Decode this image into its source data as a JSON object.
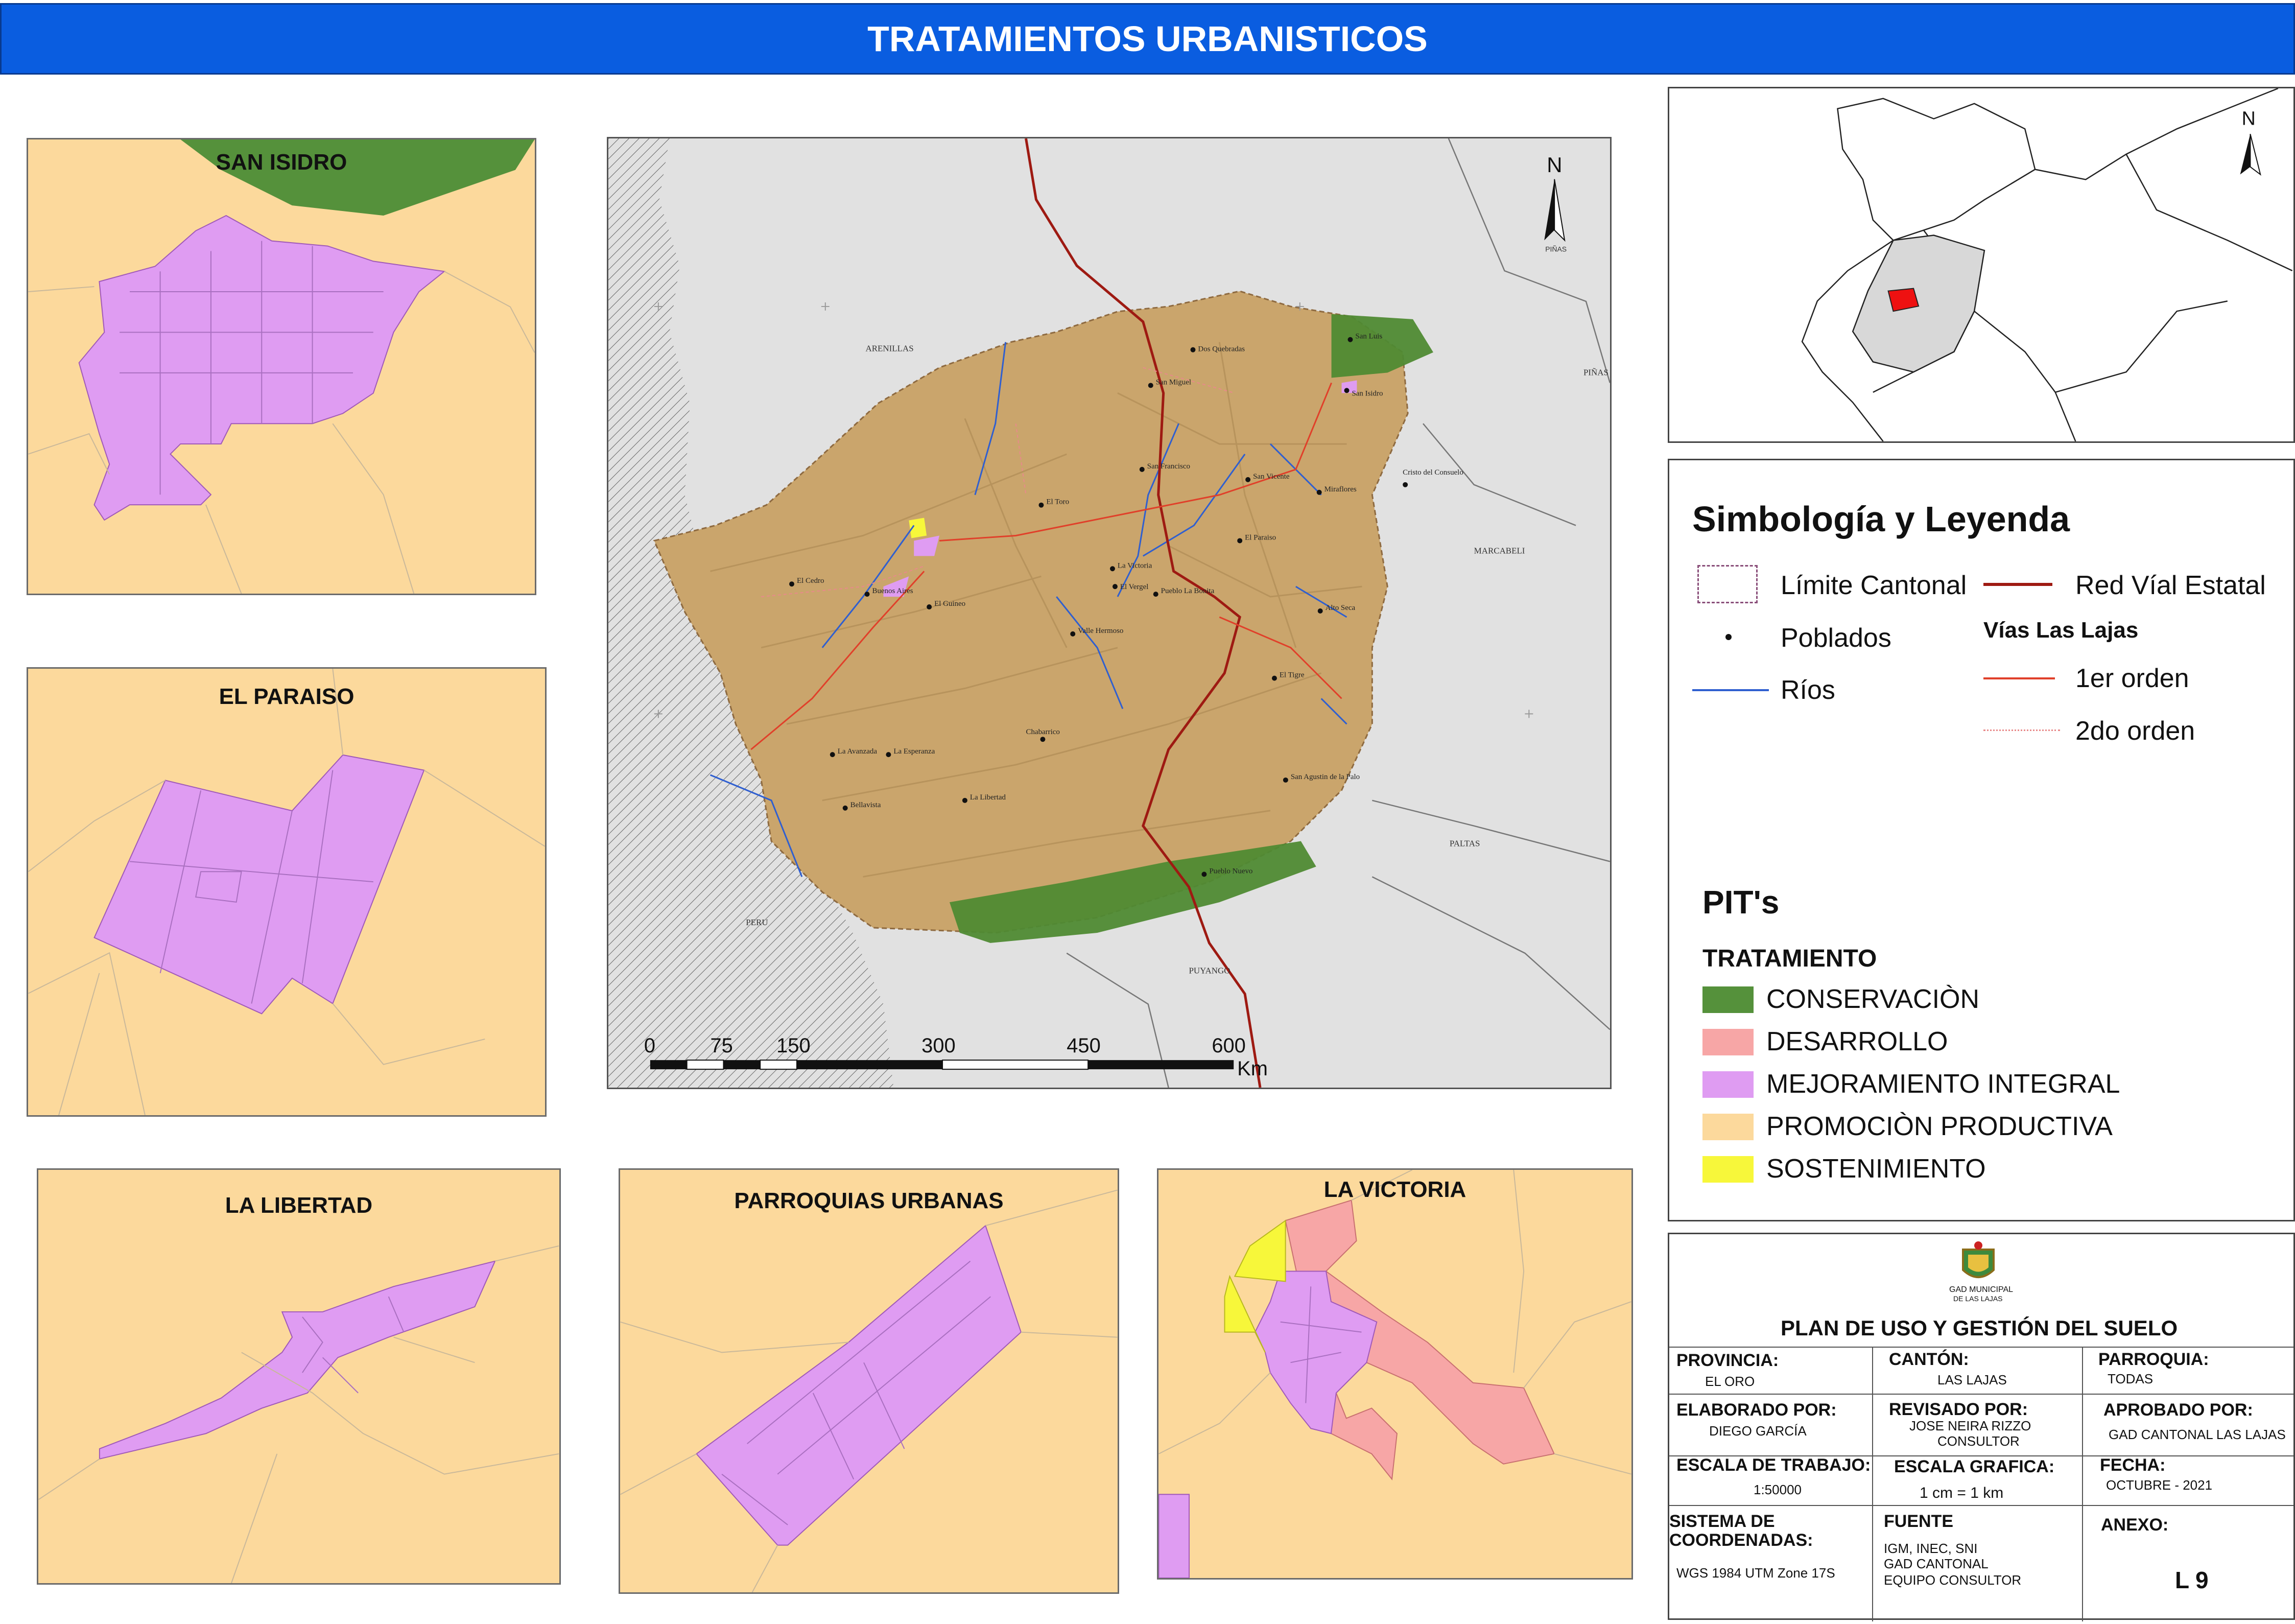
{
  "header": {
    "title": "TRATAMIENTOS URBANISTICOS"
  },
  "insets": {
    "san_isidro": "SAN ISIDRO",
    "el_paraiso": "EL PARAISO",
    "la_libertad": "LA LIBERTAD",
    "parroquias_urbanas": "PARROQUIAS URBANAS",
    "la_victoria": "LA VICTORIA"
  },
  "main_map": {
    "north": "N",
    "north_sub": "PIÑAS",
    "neighbors": [
      "ARENILLAS",
      "PIÑAS",
      "MARCABELI",
      "PALTAS",
      "PERU",
      "PUYANGO"
    ],
    "towns": [
      "Dos Quebradas",
      "San Luis",
      "San Miguel",
      "San Isidro",
      "San Francisco",
      "San Vicente",
      "Miraflores",
      "Cristo del Consuelo",
      "El Toro",
      "El Paraiso",
      "La Victoria",
      "El Vergel",
      "Pueblo La Bonita",
      "El Cedro",
      "Buenos Aires",
      "El Guineo",
      "Valle Hermoso",
      "Alto Seca",
      "El Tigre",
      "Chabarrico",
      "La Avanzada",
      "La Esperanza",
      "Bellavista",
      "La Libertad",
      "San Agustin de la Palo",
      "Pueblo Nuevo"
    ],
    "scale_labels": [
      "0",
      "75",
      "150",
      "300",
      "450",
      "600"
    ],
    "scale_unit": "Km"
  },
  "locator": {
    "north": "N"
  },
  "legend": {
    "title": "Simbología y Leyenda",
    "limite": "Límite Cantonal",
    "red_vial": "Red Víal Estatal",
    "poblados": "Poblados",
    "vias_title": "Vías Las Lajas",
    "rios": "Ríos",
    "primer_orden": "1er orden",
    "segundo_orden": "2do orden",
    "pits_title": "PIT's",
    "tratamiento_title": "TRATAMIENTO",
    "items": [
      {
        "label": "CONSERVACIÒN",
        "color": "#55913b"
      },
      {
        "label": "DESARROLLO",
        "color": "#f7a6a6"
      },
      {
        "label": "MEJORAMIENTO INTEGRAL",
        "color": "#df9cf2"
      },
      {
        "label": "PROMOCIÒN PRODUCTIVA",
        "color": "#fcd99c"
      },
      {
        "label": "SOSTENIMIENTO",
        "color": "#f7f73a"
      }
    ]
  },
  "titleblock": {
    "org_name": "GAD MUNICIPAL",
    "org_sub": "DE LAS LAJAS",
    "plan_title": "PLAN DE USO Y GESTIÓN DEL SUELO",
    "provincia_h": "PROVINCIA:",
    "provincia_v": "EL ORO",
    "canton_h": "CANTÓN:",
    "canton_v": "LAS LAJAS",
    "parroquia_h": "PARROQUIA:",
    "parroquia_v": "TODAS",
    "elaborado_h": "ELABORADO POR:",
    "elaborado_v": "DIEGO GARCÍA",
    "revisado_h": "REVISADO POR:",
    "revisado_v1": "JOSE NEIRA RIZZO",
    "revisado_v2": "CONSULTOR",
    "aprobado_h": "APROBADO POR:",
    "aprobado_v": "GAD CANTONAL LAS LAJAS",
    "escala_trabajo_h": "ESCALA DE TRABAJO:",
    "escala_trabajo_v": "1:50000",
    "escala_grafica_h": "ESCALA GRAFICA:",
    "escala_grafica_v": "1 cm = 1 km",
    "fecha_h": "FECHA:",
    "fecha_v": "OCTUBRE - 2021",
    "sistema_h1": "SISTEMA DE",
    "sistema_h2": "COORDENADAS:",
    "sistema_v": "WGS 1984 UTM Zone 17S",
    "fuente_h": "FUENTE",
    "fuente_v1": "IGM, INEC, SNI",
    "fuente_v2": "GAD CANTONAL",
    "fuente_v3": "EQUIPO CONSULTOR",
    "anexo_h": "ANEXO:",
    "anexo_v": "L 9"
  }
}
